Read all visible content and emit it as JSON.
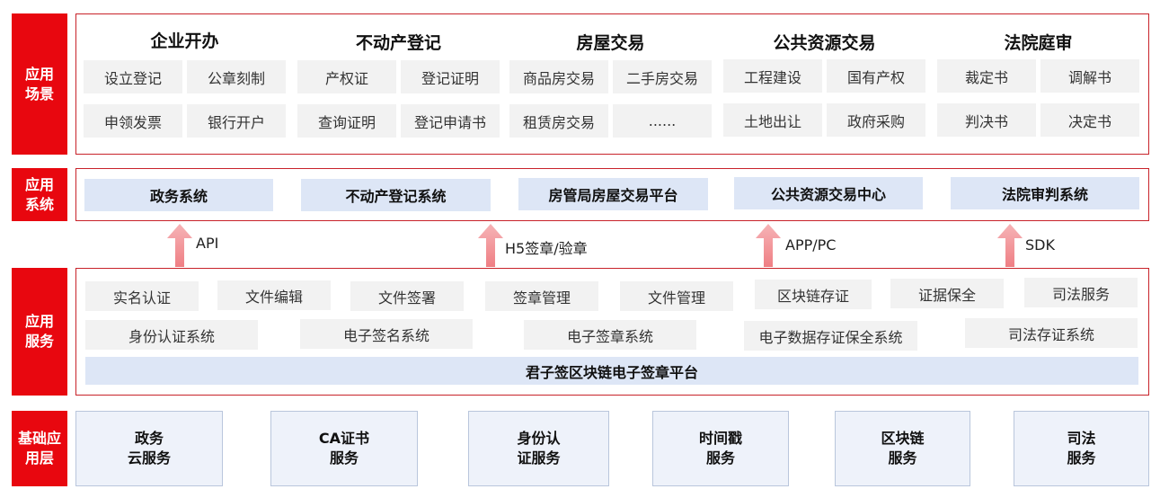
{
  "layers": {
    "scenarios": "应用\n场景",
    "systems": "应用\n系统",
    "services": "应用\n服务",
    "foundation": "基础应\n用层"
  },
  "scenario_groups": [
    {
      "title": "企业开办",
      "items": [
        "设立登记",
        "公章刻制",
        "申领发票",
        "银行开户"
      ]
    },
    {
      "title": "不动产登记",
      "items": [
        "产权证",
        "登记证明",
        "查询证明",
        "登记申请书"
      ]
    },
    {
      "title": "房屋交易",
      "items": [
        "商品房交易",
        "二手房交易",
        "租赁房交易",
        "......"
      ]
    },
    {
      "title": "公共资源交易",
      "items": [
        "工程建设",
        "国有产权",
        "土地出让",
        "政府采购"
      ]
    },
    {
      "title": "法院庭审",
      "items": [
        "裁定书",
        "调解书",
        "判决书",
        "决定书"
      ]
    }
  ],
  "systems": [
    "政务系统",
    "不动产登记系统",
    "房管局房屋交易平台",
    "公共资源交易中心",
    "法院审判系统"
  ],
  "interfaces": [
    "API",
    "H5签章/验章",
    "APP/PC",
    "SDK"
  ],
  "services_row1": [
    "实名认证",
    "文件编辑",
    "文件签署",
    "签章管理",
    "文件管理",
    "区块链存证",
    "证据保全",
    "司法服务"
  ],
  "services_row2": [
    "身份认证系统",
    "电子签名系统",
    "电子签章系统",
    "电子数据存证保全系统",
    "司法存证系统"
  ],
  "platform": "君子签区块链电子签章平台",
  "foundation_items": [
    "政务\n云服务",
    "CA证书\n服务",
    "身份认\n证服务",
    "时间戳\n服务",
    "区块链\n服务",
    "司法\n服务"
  ],
  "colors": {
    "accent_red": "#e8070f",
    "frame_red": "#c8232a",
    "system_blue": "#dde6f6",
    "arrow_pink": "#f4a0a3"
  }
}
